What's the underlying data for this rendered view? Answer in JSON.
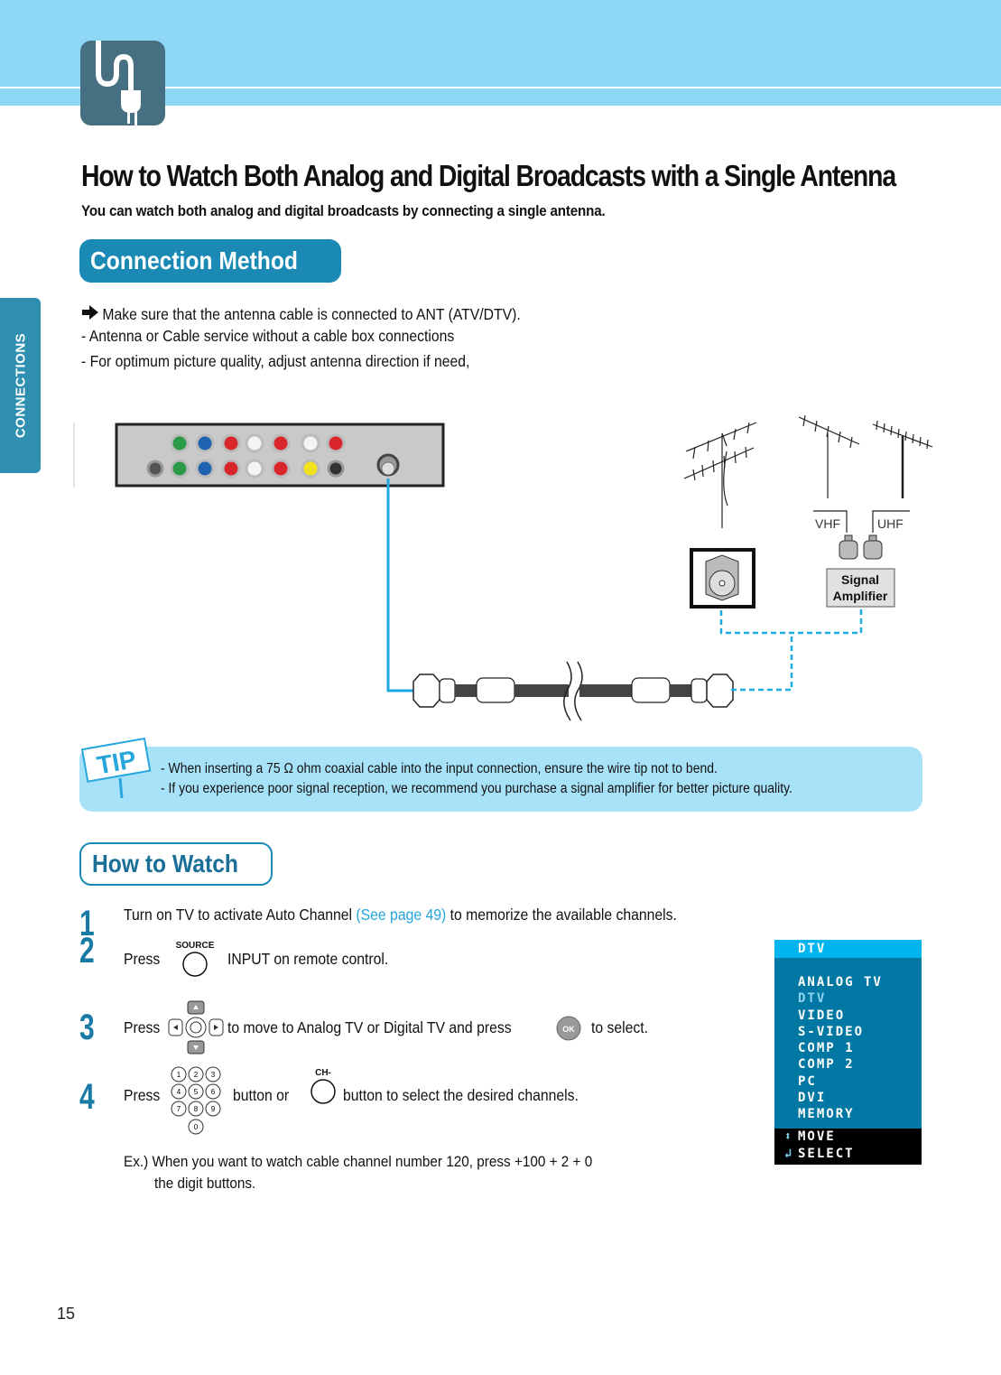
{
  "header": {
    "chapter_icon": "plug-icon"
  },
  "side_tab": {
    "label": "CONNECTIONS"
  },
  "title": "How to Watch Both Analog and Digital Broadcasts with a Single Antenna",
  "subtitle": "You can watch both analog and digital broadcasts by connecting a single antenna.",
  "connection_method": {
    "heading": "Connection Method",
    "lines": [
      "Make sure that the antenna cable is connected to ANT (ATV/DTV).",
      "- Antenna or Cable service without a cable box connections",
      "- For optimum picture quality, adjust antenna direction if need,"
    ]
  },
  "diagram": {
    "vhf_label": "VHF",
    "uhf_label": "UHF",
    "amplifier_label_1": "Signal",
    "amplifier_label_2": "Amplifier",
    "colors": {
      "solid_cable": "#1fa9e1",
      "dashed_cable": "#1fa9e1"
    }
  },
  "tip": {
    "badge": "TIP",
    "lines": [
      "- When inserting a 75 Ω  ohm coaxial cable into the input connection, ensure the wire tip not to bend.",
      "- If you experience poor signal reception, we recommend you purchase a signal amplifier for better picture quality."
    ]
  },
  "how_to_watch": {
    "heading": "How to Watch",
    "steps": [
      {
        "number": "1",
        "text_before": "Turn on TV to activate Auto Channel ",
        "link": "(See page 49)",
        "text_after": " to memorize the available channels."
      },
      {
        "number": "2",
        "press": "Press",
        "button_label": "SOURCE",
        "text_after": "INPUT on remote control."
      },
      {
        "number": "3",
        "press": "Press",
        "text_mid": "to move to Analog TV or Digital TV and press",
        "ok_label": "OK",
        "text_after": "to select."
      },
      {
        "number": "4",
        "press": "Press",
        "digits": [
          "1",
          "2",
          "3",
          "4",
          "5",
          "6",
          "7",
          "8",
          "9",
          "0"
        ],
        "text_mid": "button or",
        "ch_label": "CH-",
        "text_after": "button to select the desired channels."
      }
    ],
    "example_line_1": "Ex.) When you want to watch cable channel number 120, press   +100  +  2  +  0",
    "example_line_2": "the digit buttons."
  },
  "osd_menu": {
    "header": "DTV",
    "items": [
      "ANALOG TV",
      "DTV",
      "VIDEO",
      "S-VIDEO",
      "COMP 1",
      "COMP 2",
      "PC",
      "DVI",
      "MEMORY"
    ],
    "active_index": 1,
    "footer_move": "MOVE",
    "footer_select": "SELECT",
    "colors": {
      "header_bg": "#00b4ef",
      "body_bg": "#0078a3",
      "footer_bg": "#000000"
    }
  },
  "page_number": "15"
}
